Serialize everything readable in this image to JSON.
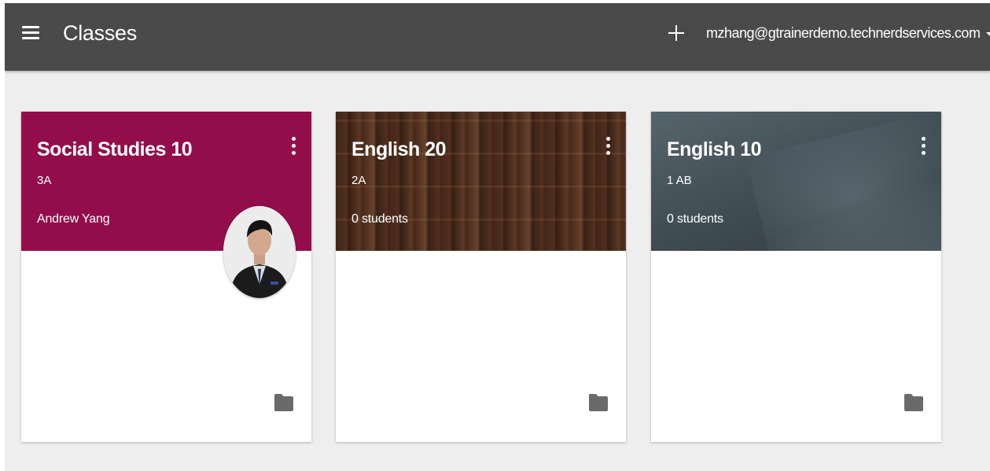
{
  "app": {
    "title": "Classes",
    "account_email": "mzhang@gtrainerdemo.technerdservices.com"
  },
  "icons": {
    "menu": "menu-icon",
    "add": "add-icon",
    "account_dropdown": "chevron-down-icon",
    "card_menu": "more-vert-icon",
    "folder": "folder-icon"
  },
  "colors": {
    "topbar": "#4a4a4a",
    "background": "#eeeeee",
    "card_social_studies": "#930d4b"
  },
  "classes": [
    {
      "title": "Social Studies 10",
      "section": "3A",
      "meta": "Andrew Yang"
    },
    {
      "title": "English 20",
      "section": "2A",
      "meta": "0 students"
    },
    {
      "title": "English 10",
      "section": "1 AB",
      "meta": "0 students"
    }
  ]
}
